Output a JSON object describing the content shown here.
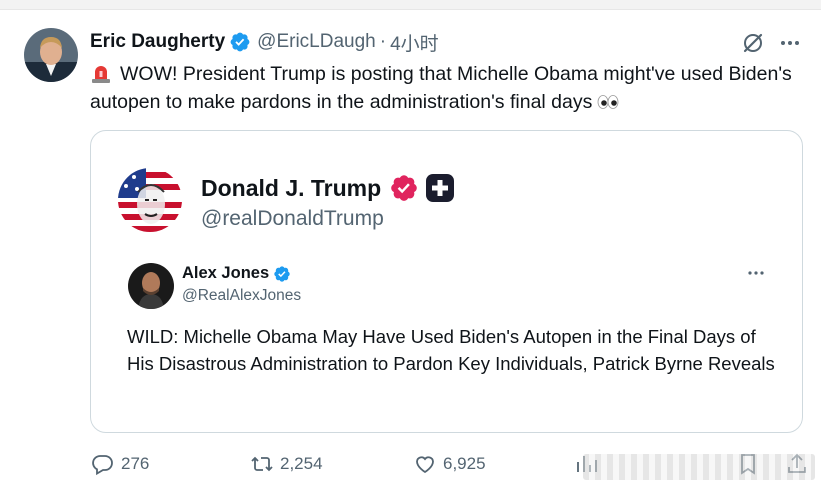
{
  "tweet": {
    "author_name": "Eric Daugherty",
    "author_handle": "@EricLDaugh",
    "separator": "·",
    "time": "4小时",
    "text": "WOW! President Trump is posting that Michelle Obama might've used Biden's autopen to make pardons in the administration's final days"
  },
  "quote": {
    "name": "Donald J. Trump",
    "handle": "@realDonaldTrump",
    "inner_post": {
      "name": "Alex Jones",
      "handle": "@RealAlexJones",
      "text": "WILD: Michelle Obama May Have Used Biden's Autopen in the Final Days of His Disastrous Administration to Pardon Key Individuals, Patrick Byrne Reveals"
    }
  },
  "actions": {
    "replies": "276",
    "reposts": "2,254",
    "likes": "6,925"
  },
  "icons": {
    "author_verified": "verified-badge-icon",
    "trump_badge": "pink-verified-badge-icon",
    "trump_plus": "plus-badge-icon",
    "jones_verified": "verified-badge-icon",
    "grok": "grok-icon",
    "more": "more-icon",
    "reply": "reply-icon",
    "retweet": "retweet-icon",
    "like": "like-icon",
    "views": "views-icon",
    "bookmark": "bookmark-icon",
    "share": "share-icon",
    "siren": "siren-emoji-icon",
    "eyes": "eyes-emoji-icon"
  },
  "colors": {
    "text": "#0f1419",
    "secondary": "#536471",
    "verified_blue": "#1d9bf0",
    "pink_badge": "#e0245e",
    "border": "#cfd9de"
  }
}
